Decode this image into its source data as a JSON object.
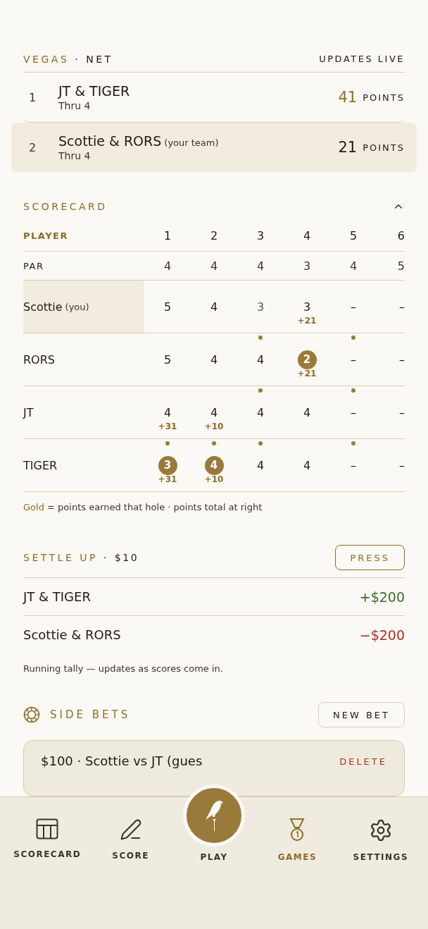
{
  "game": {
    "title": "VEGAS",
    "separator": "·",
    "format": "NET",
    "status": "UPDATES LIVE"
  },
  "standings": [
    {
      "rank": "1",
      "team": "JT & TIGER",
      "thru": "Thru 4",
      "points": "41",
      "unit": "POINTS",
      "leading": true,
      "selected": false
    },
    {
      "rank": "2",
      "team": "Scottie & RORS",
      "note": "(your team)",
      "thru": "Thru 4",
      "points": "21",
      "unit": "POINTS",
      "leading": false,
      "selected": true
    }
  ],
  "scorecard": {
    "title": "SCORECARD",
    "expanded": true,
    "player_heading": "PLAYER",
    "holes": [
      "1",
      "2",
      "3",
      "4",
      "5",
      "6"
    ],
    "par_label": "PAR",
    "par": [
      "4",
      "4",
      "4",
      "3",
      "4",
      "5"
    ],
    "players": [
      {
        "name": "Scottie",
        "note": "(you)",
        "self": true,
        "cells": [
          {
            "score": "5",
            "kind": "plain",
            "dot": false
          },
          {
            "score": "4",
            "kind": "plain",
            "dot": false
          },
          {
            "score": "3",
            "kind": "birdie",
            "dot": false
          },
          {
            "score": "3",
            "kind": "plain",
            "dot": false,
            "points": "+21"
          },
          {
            "score": "–",
            "kind": "plain",
            "dot": false
          },
          {
            "score": "–",
            "kind": "plain",
            "dot": false
          }
        ]
      },
      {
        "name": "RORS",
        "self": false,
        "cells": [
          {
            "score": "5",
            "kind": "plain",
            "dot": false
          },
          {
            "score": "4",
            "kind": "plain",
            "dot": false
          },
          {
            "score": "4",
            "kind": "plain",
            "dot": true
          },
          {
            "score": "2",
            "kind": "win",
            "dot": false,
            "points": "+21"
          },
          {
            "score": "–",
            "kind": "plain",
            "dot": true
          },
          {
            "score": "–",
            "kind": "plain",
            "dot": false
          }
        ]
      },
      {
        "name": "JT",
        "self": false,
        "cells": [
          {
            "score": "4",
            "kind": "plain",
            "dot": false,
            "points": "+31"
          },
          {
            "score": "4",
            "kind": "plain",
            "dot": false,
            "points": "+10"
          },
          {
            "score": "4",
            "kind": "plain",
            "dot": true
          },
          {
            "score": "4",
            "kind": "plain",
            "dot": false
          },
          {
            "score": "–",
            "kind": "plain",
            "dot": true
          },
          {
            "score": "–",
            "kind": "plain",
            "dot": false
          }
        ]
      },
      {
        "name": "TIGER",
        "self": false,
        "cells": [
          {
            "score": "3",
            "kind": "win",
            "dot": true,
            "points": "+31"
          },
          {
            "score": "4",
            "kind": "win",
            "dot": true,
            "points": "+10"
          },
          {
            "score": "4",
            "kind": "plain",
            "dot": true
          },
          {
            "score": "4",
            "kind": "plain",
            "dot": false
          },
          {
            "score": "–",
            "kind": "plain",
            "dot": true
          },
          {
            "score": "–",
            "kind": "plain",
            "dot": false
          }
        ]
      }
    ],
    "legend_key": "Gold",
    "legend": "= points earned that hole · points total at right"
  },
  "settle": {
    "title": "SETTLE UP",
    "separator": "·",
    "stake": "$10",
    "button": "PRESS",
    "rows": [
      {
        "team": "JT & TIGER",
        "amount": "+$200",
        "kind": "gain"
      },
      {
        "team": "Scottie & RORS",
        "amount": "−$200",
        "kind": "loss"
      }
    ],
    "note": "Running tally — updates as scores come in."
  },
  "side_bets": {
    "title": "SIDE BETS",
    "button": "NEW BET",
    "bets": [
      {
        "label": "$100 · Scottie vs JT (gues",
        "action": "DELETE"
      }
    ]
  },
  "nav": [
    {
      "label": "SCORECARD",
      "kind": "scorecard",
      "selected": false
    },
    {
      "label": "SCORE",
      "kind": "score",
      "selected": false
    },
    {
      "label": "PLAY",
      "kind": "play",
      "selected": false
    },
    {
      "label": "GAMES",
      "kind": "games",
      "selected": true
    },
    {
      "label": "SETTINGS",
      "kind": "settings",
      "selected": false
    }
  ]
}
